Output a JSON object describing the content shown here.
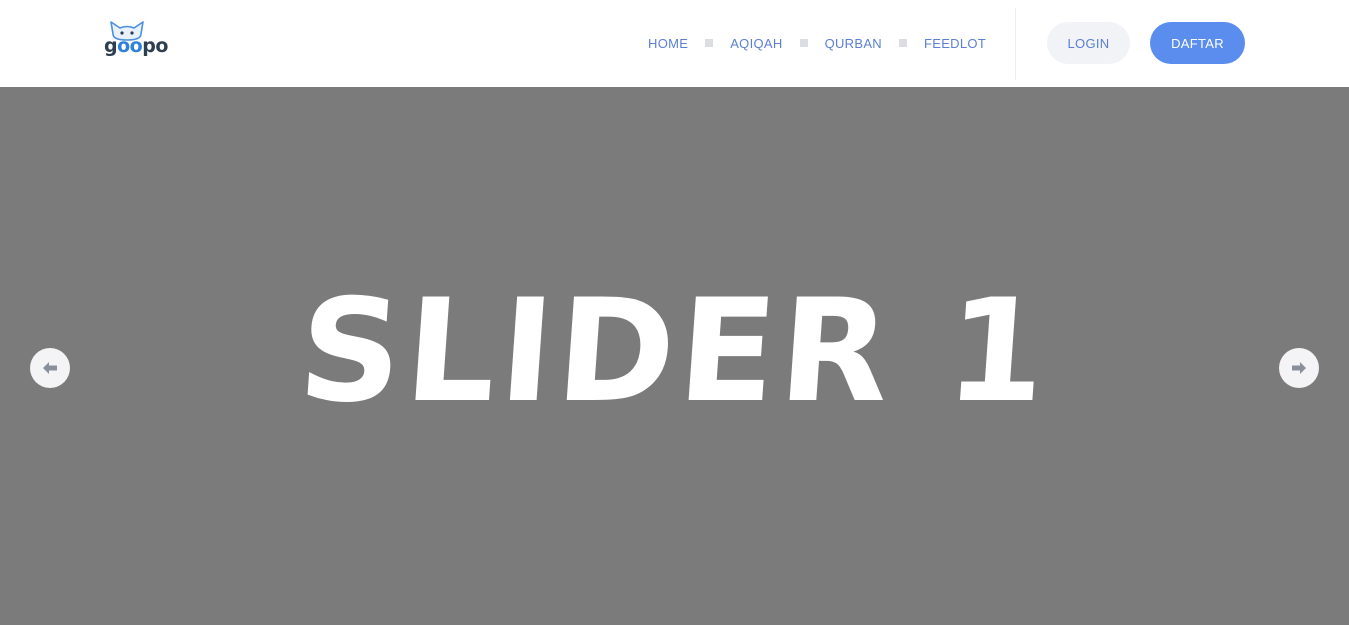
{
  "brand": {
    "logo_text_start": "g",
    "logo_text_o1": "o",
    "logo_text_o2": "o",
    "logo_text_end": "po",
    "logo_icon": "cat-face-icon"
  },
  "nav": {
    "items": [
      {
        "label": "HOME"
      },
      {
        "label": "AQIQAH"
      },
      {
        "label": "QURBAN"
      },
      {
        "label": "FEEDLOT"
      }
    ]
  },
  "auth": {
    "login_label": "LOGIN",
    "register_label": "DAFTAR"
  },
  "slider": {
    "title": "SLIDER 1",
    "prev_icon": "arrow-left-icon",
    "next_icon": "arrow-right-icon"
  },
  "colors": {
    "nav_text": "#5b7fd6",
    "primary_button": "#5b8def",
    "secondary_button": "#f2f3f6",
    "slider_background": "#7b7b7b",
    "logo_dark": "#2c3e50",
    "logo_accent": "#2f80d9"
  }
}
